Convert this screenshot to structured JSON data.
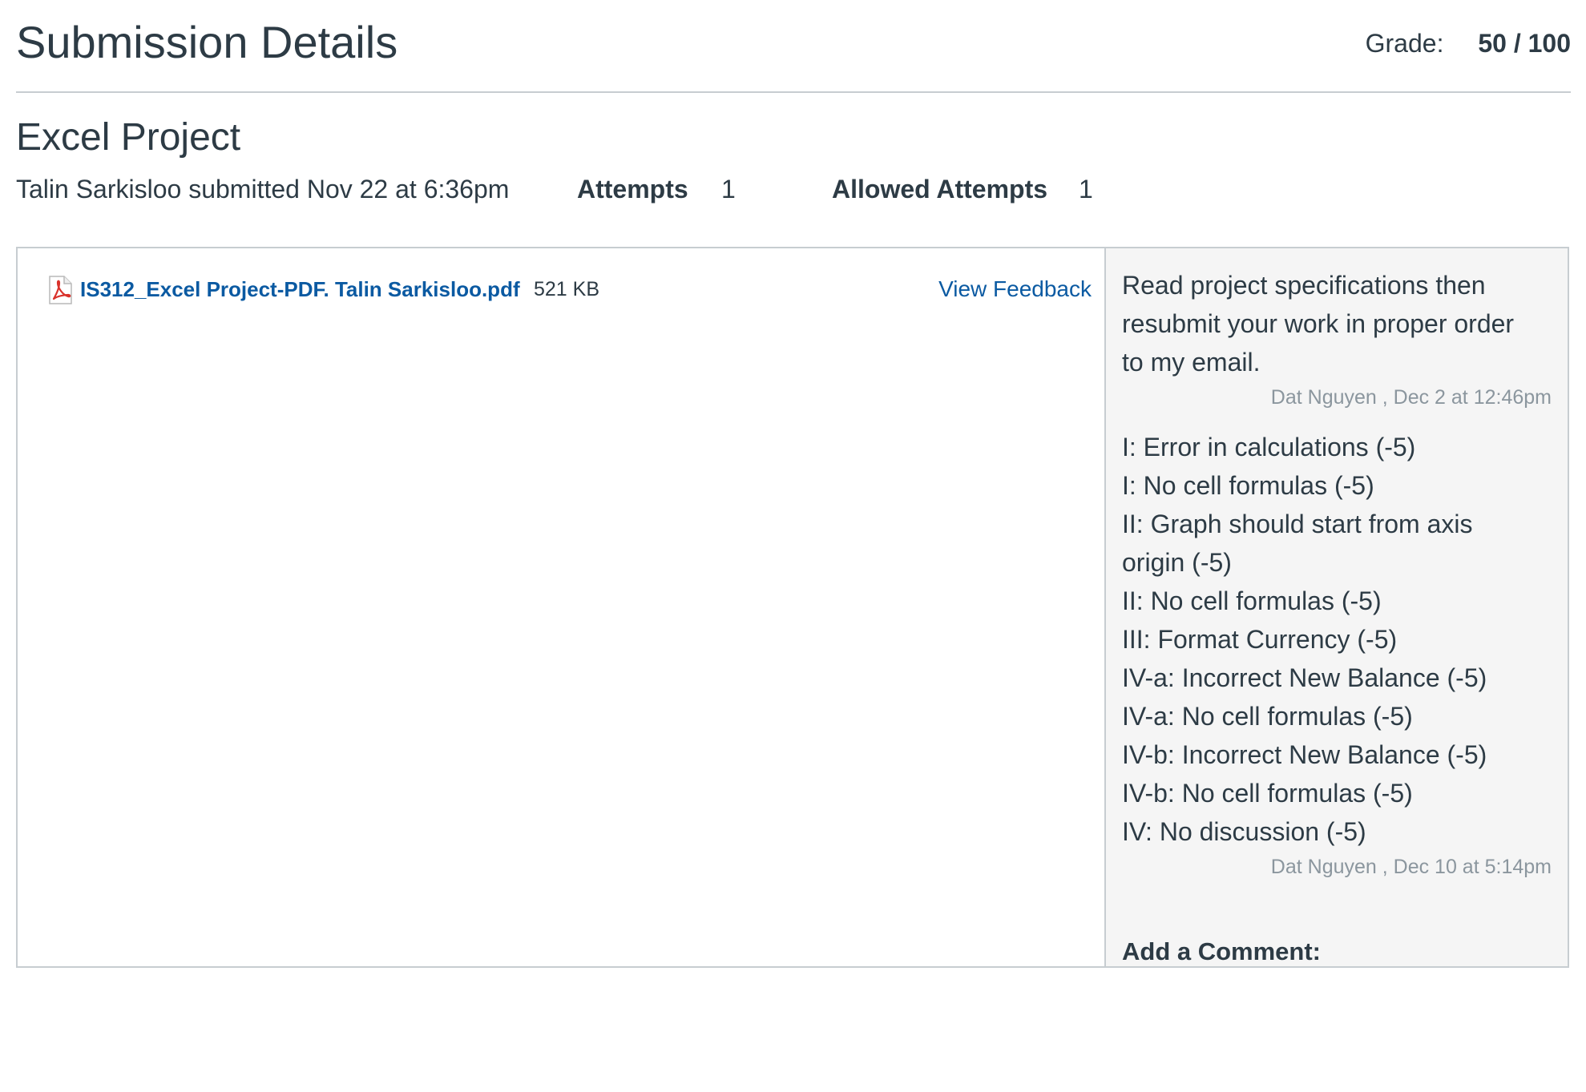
{
  "header": {
    "title": "Submission Details",
    "grade_label": "Grade:",
    "grade_value": "50 / 100"
  },
  "assignment": {
    "title": "Excel Project",
    "submitted_text": "Talin Sarkisloo submitted Nov 22 at 6:36pm",
    "attempts_label": "Attempts",
    "attempts_value": "1",
    "allowed_attempts_label": "Allowed Attempts",
    "allowed_attempts_value": "1"
  },
  "file": {
    "name": "IS312_Excel Project-PDF. Talin Sarkisloo.pdf",
    "size": "521 KB",
    "icon": "pdf-icon",
    "view_feedback_label": "View Feedback"
  },
  "comments": {
    "items": [
      {
        "lines": [
          "Read project specifications then",
          "resubmit your work in proper order",
          "to my email."
        ],
        "meta": "Dat Nguyen , Dec 2 at 12:46pm"
      },
      {
        "lines": [
          "I: Error in calculations (-5)",
          "I: No cell formulas (-5)",
          "II: Graph should start from axis",
          "origin (-5)",
          "II: No cell formulas (-5)",
          "III: Format Currency (-5)",
          "IV-a: Incorrect New Balance (-5)",
          "IV-a: No cell formulas (-5)",
          "IV-b: Incorrect New Balance (-5)",
          "IV-b: No cell formulas (-5)",
          "IV: No discussion (-5)"
        ],
        "meta": "Dat Nguyen , Dec 10 at 5:14pm"
      }
    ],
    "add_comment_label": "Add a Comment:"
  },
  "colors": {
    "link": "#0b5aa2",
    "text": "#2d3b45",
    "meta": "#8b969e",
    "panel_bg": "#f5f5f5",
    "border": "#c7cdd1",
    "pdf_red": "#d9322b"
  }
}
